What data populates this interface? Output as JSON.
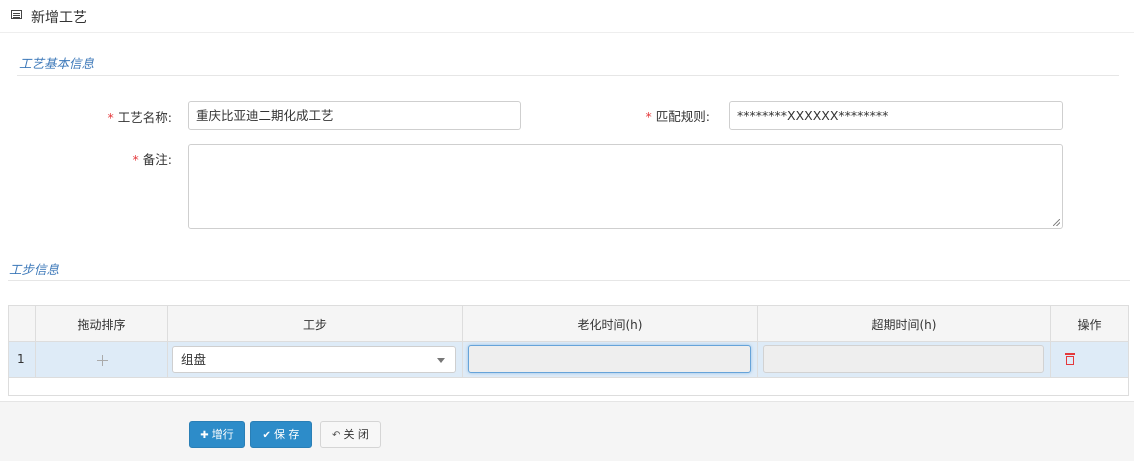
{
  "header": {
    "title": "新增工艺",
    "icon": "list-icon"
  },
  "sections": {
    "basic_info": "工艺基本信息",
    "step_info": "工步信息"
  },
  "form": {
    "required_mark": "*",
    "process_name_label": "工艺名称:",
    "process_name_value": "重庆比亚迪二期化成工艺",
    "match_rule_label": "匹配规则:",
    "match_rule_value": "********XXXXXX********",
    "remark_label": "备注:",
    "remark_value": ""
  },
  "table": {
    "columns": [
      "拖动排序",
      "工步",
      "老化时间(h)",
      "超期时间(h)",
      "操作"
    ],
    "rows": [
      {
        "index": "1",
        "step": "组盘",
        "aging_time": "",
        "overdue_time": ""
      }
    ]
  },
  "buttons": {
    "add_row": "增行",
    "save": "保 存",
    "close": "关 闭"
  },
  "colors": {
    "accent": "#2d8cc9",
    "section_title": "#3c78b9",
    "required": "#e4393c",
    "row_highlight": "#deebf7"
  }
}
